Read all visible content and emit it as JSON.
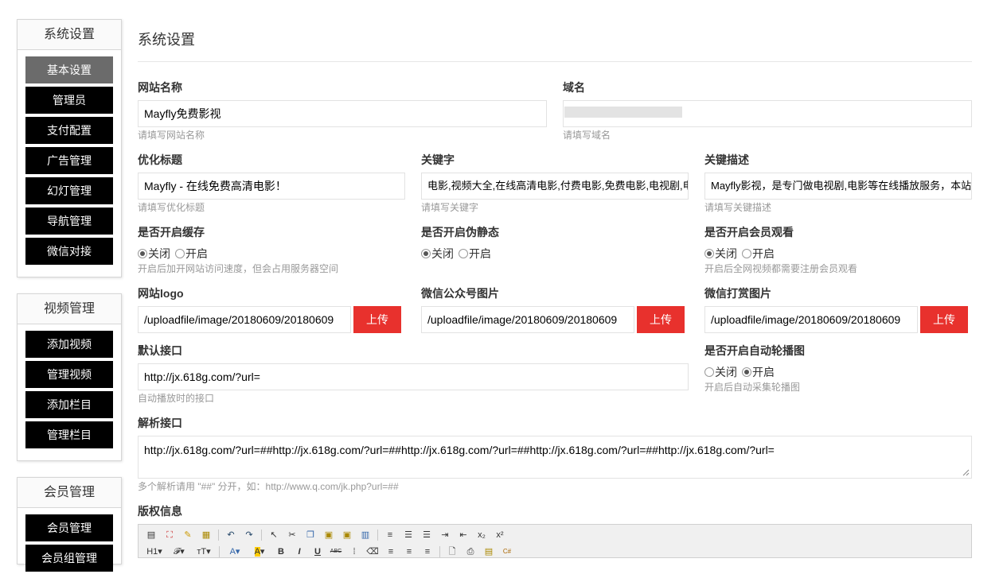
{
  "sidebar": {
    "groups": [
      {
        "title": "系统设置",
        "items": [
          "基本设置",
          "管理员",
          "支付配置",
          "广告管理",
          "幻灯管理",
          "导航管理",
          "微信对接"
        ],
        "active": 0
      },
      {
        "title": "视频管理",
        "items": [
          "添加视频",
          "管理视频",
          "添加栏目",
          "管理栏目"
        ]
      },
      {
        "title": "会员管理",
        "items": [
          "会员管理",
          "会员组管理"
        ]
      }
    ]
  },
  "page": {
    "title": "系统设置"
  },
  "fields": {
    "site_name": {
      "label": "网站名称",
      "value": "Mayfly免费影视",
      "help": "请填写网站名称"
    },
    "domain": {
      "label": "域名",
      "value": "",
      "help": "请填写域名"
    },
    "seo_title": {
      "label": "优化标题",
      "value": "Mayfly - 在线免费高清电影！",
      "help": "请填写优化标题"
    },
    "keywords": {
      "label": "关键字",
      "value": "电影,视频大全,在线高清电影,付费电影,免费电影,电视剧,电",
      "help": "请填写关键字"
    },
    "description": {
      "label": "关键描述",
      "value": "Mayfly影视，是专门做电视剧,电影等在线播放服务，本站",
      "help": "请填写关键描述"
    },
    "cache": {
      "label": "是否开启缓存",
      "options": [
        "关闭",
        "开启"
      ],
      "selected": "关闭",
      "help": "开启后加开网站访问速度，但会占用服务器空间"
    },
    "pseudo_static": {
      "label": "是否开启伪静态",
      "options": [
        "关闭",
        "开启"
      ],
      "selected": "关闭"
    },
    "member_watch": {
      "label": "是否开启会员观看",
      "options": [
        "关闭",
        "开启"
      ],
      "selected": "关闭",
      "help": "开启后全网视频都需要注册会员观看"
    },
    "logo": {
      "label": "网站logo",
      "value": "/uploadfile/image/20180609/20180609",
      "button": "上传"
    },
    "wechat_image": {
      "label": "微信公众号图片",
      "value": "/uploadfile/image/20180609/20180609",
      "button": "上传"
    },
    "reward_image": {
      "label": "微信打赏图片",
      "value": "/uploadfile/image/20180609/20180609",
      "button": "上传"
    },
    "default_api": {
      "label": "默认接口",
      "value": "http://jx.618g.com/?url=",
      "help": "自动播放时的接口"
    },
    "auto_carousel": {
      "label": "是否开启自动轮播图",
      "options": [
        "关闭",
        "开启"
      ],
      "selected": "开启",
      "help": "开启后自动采集轮播图"
    },
    "parse_api": {
      "label": "解析接口",
      "value": "http://jx.618g.com/?url=##http://jx.618g.com/?url=##http://jx.618g.com/?url=##http://jx.618g.com/?url=##http://jx.618g.com/?url=",
      "help": "多个解析请用 \"##\" 分开，如：http://www.q.com/jk.php?url=##"
    },
    "copyright": {
      "label": "版权信息"
    }
  },
  "editor": {
    "row1": [
      "source-icon",
      "fullscreen-icon",
      "clear-format-icon",
      "paste-text-icon",
      "|",
      "undo-icon",
      "redo-icon",
      "|",
      "select-icon",
      "cut-icon",
      "copy-icon",
      "paste-icon",
      "paste-plain-icon",
      "paste-word-icon",
      "|",
      "justify-full-icon",
      "ordered-list-icon",
      "unordered-list-icon",
      "indent-icon",
      "outdent-icon",
      "subscript-icon",
      "superscript-icon"
    ],
    "row2": [
      "heading-icon",
      "font-family-icon",
      "font-size-icon",
      "|",
      "font-color-icon",
      "highlight-icon",
      "bold-icon",
      "italic-icon",
      "underline-icon",
      "strikethrough-icon",
      "line-height-icon",
      "remove-format-icon",
      "align-left-icon",
      "align-center-icon",
      "align-right-icon",
      "|",
      "preview-icon",
      "print-icon",
      "template-icon",
      "code-icon"
    ],
    "labels": {
      "heading": "H1",
      "font_family": "𝓕",
      "font_size": "ᴛT",
      "font_color": "A",
      "highlight": "A",
      "bold": "B",
      "italic": "I",
      "underline": "U",
      "strikethrough": "ABC",
      "subscript": "x₂",
      "superscript": "x²"
    }
  }
}
